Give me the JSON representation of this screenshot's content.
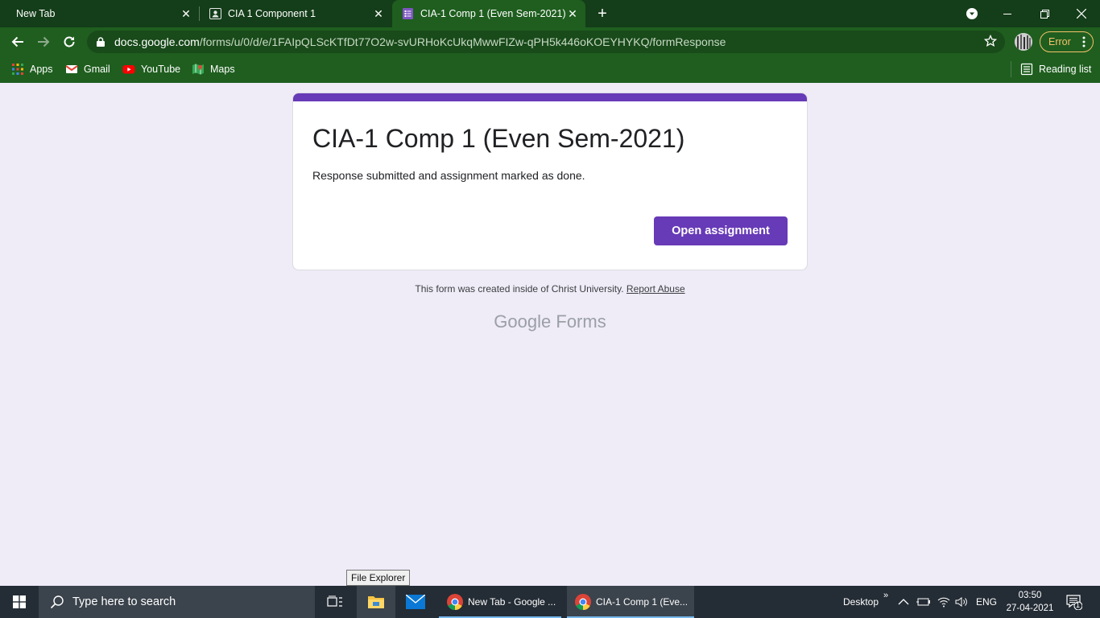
{
  "browser": {
    "tabs": [
      {
        "label": "New Tab"
      },
      {
        "label": "CIA 1 Component 1"
      },
      {
        "label": "CIA-1 Comp 1 (Even Sem-2021)"
      }
    ],
    "url_host": "docs.google.com",
    "url_path": "/forms/u/0/d/e/1FAIpQLScKTfDt77O2w-svURHoKcUkqMwwFIZw-qPH5k446oKOEYHYKQ/formResponse",
    "error_label": "Error",
    "bookmarks": [
      {
        "label": "Apps",
        "icon": "apps-grid-icon"
      },
      {
        "label": "Gmail",
        "icon": "gmail-icon"
      },
      {
        "label": "YouTube",
        "icon": "youtube-icon"
      },
      {
        "label": "Maps",
        "icon": "maps-icon"
      }
    ],
    "reading_list": "Reading list"
  },
  "form": {
    "title": "CIA-1 Comp 1 (Even Sem-2021)",
    "message": "Response submitted and assignment marked as done.",
    "button": "Open assignment",
    "footer_text": "This form was created inside of Christ University.",
    "report_abuse": "Report Abuse",
    "brand_google": "Google",
    "brand_forms": "Forms",
    "accent_color": "#673ab7"
  },
  "taskbar": {
    "search_placeholder": "Type here to search",
    "tooltip": "File Explorer",
    "apps": [
      {
        "label": "New Tab - Google ..."
      },
      {
        "label": "CIA-1 Comp 1 (Eve..."
      }
    ],
    "desktop_label": "Desktop",
    "chevron": "»",
    "language": "ENG",
    "time": "03:50",
    "date": "27-04-2021",
    "notification_count": "1"
  }
}
